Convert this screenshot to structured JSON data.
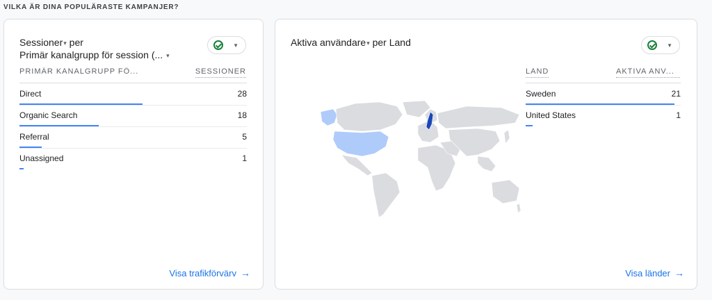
{
  "section_title": "VILKA ÄR DINA POPULÄRASTE KAMPANJER?",
  "card1": {
    "title_line1_metric": "Sessioner",
    "title_line1_rest": " per",
    "title_line2": "Primär kanalgrupp för session (...",
    "dropdown_glyph": "▾",
    "col_dimension": "PRIMÄR KANALGRUPP FÖ...",
    "col_metric": "SESSIONER",
    "rows": [
      {
        "label": "Direct",
        "value": "28",
        "share": 1.0
      },
      {
        "label": "Organic Search",
        "value": "18",
        "share": 0.643
      },
      {
        "label": "Referral",
        "value": "5",
        "share": 0.179
      },
      {
        "label": "Unassigned",
        "value": "1",
        "share": 0.036
      }
    ],
    "link": "Visa trafikförvärv",
    "link_arrow": "→"
  },
  "card2": {
    "title_metric": "Aktiva användare",
    "title_rest": " per Land",
    "dropdown_glyph": "▾",
    "col_dimension": "LAND",
    "col_metric": "AKTIVA ANV...",
    "rows": [
      {
        "label": "Sweden",
        "value": "21",
        "share": 1.0
      },
      {
        "label": "United States",
        "value": "1",
        "share": 0.048
      }
    ],
    "link": "Visa länder",
    "link_arrow": "→",
    "map": {
      "base_color": "#dadce0",
      "highlight_strong": "#1a47b8",
      "highlight_light": "#aecbfa"
    }
  },
  "colors": {
    "accent": "#1a73e8",
    "bar": "#4285f4",
    "check": "#188038"
  },
  "icons": {
    "check_pill": "check-circle-icon",
    "pill_arrow": "caret-down-icon",
    "link_arrow": "arrow-right-icon"
  }
}
